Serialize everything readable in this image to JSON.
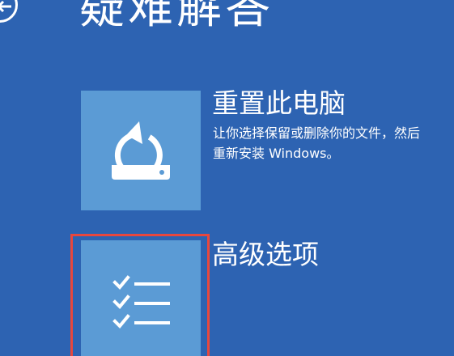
{
  "page": {
    "title": "疑难解答",
    "back_icon": "back-arrow-icon"
  },
  "options": [
    {
      "title": "重置此电脑",
      "description": "让你选择保留或删除你的文件，然后\n重新安装 Windows。",
      "icon": "reset-pc-icon"
    },
    {
      "title": "高级选项",
      "description": "",
      "icon": "checklist-icon"
    }
  ],
  "colors": {
    "background": "#2d63b2",
    "tile": "#5b9bd5",
    "highlight": "#e8473e",
    "text": "#ffffff"
  }
}
